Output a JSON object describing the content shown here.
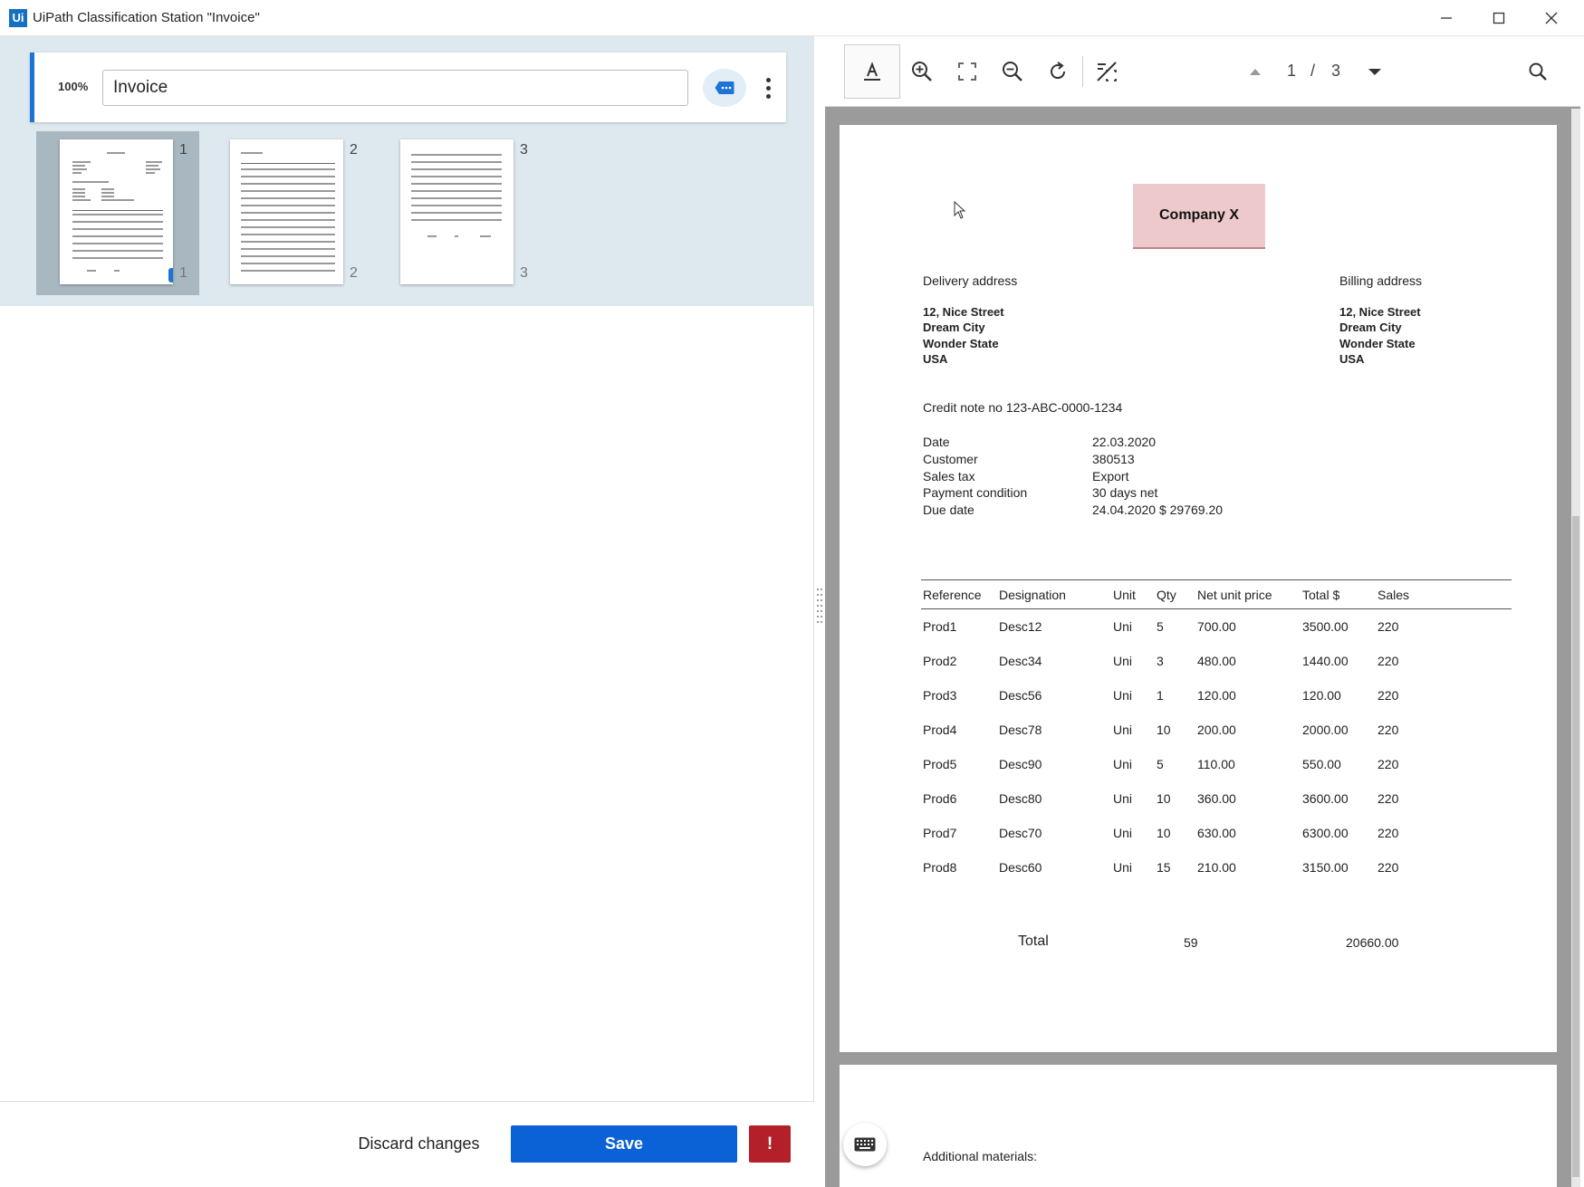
{
  "window": {
    "logo": "Ui",
    "title": "UiPath Classification Station \"Invoice\"",
    "controls": {
      "minimize": "—",
      "maximize": "☐",
      "close": "✕"
    }
  },
  "classification": {
    "confidence": "100%",
    "doc_type_value": "Invoice",
    "tag_icon": "tag-icon",
    "more_icon": "more-vertical-icon",
    "accent_color": "#1e73d6"
  },
  "thumbnails": [
    {
      "page": "1",
      "selected": true
    },
    {
      "page": "2",
      "selected": false
    },
    {
      "page": "3",
      "selected": false
    }
  ],
  "actions": {
    "discard": "Discard changes",
    "save": "Save",
    "warning": "!"
  },
  "viewer": {
    "page_current": "1",
    "page_separator": "/",
    "page_total": "3",
    "tools": [
      "text-select-icon",
      "zoom-in-icon",
      "fit-page-icon",
      "zoom-out-icon",
      "rotate-icon",
      "toggle-ocr-icon"
    ]
  },
  "document": {
    "company": "Company X",
    "delivery_label": "Delivery address",
    "billing_label": "Billing address",
    "delivery_address": [
      "12, Nice Street",
      "Dream City",
      "Wonder State",
      "USA"
    ],
    "billing_address": [
      "12, Nice Street",
      "Dream City",
      "Wonder State",
      "USA"
    ],
    "credit_note": "Credit note no 123-ABC-0000-1234",
    "details": [
      {
        "label": "Date",
        "value": "22.03.2020"
      },
      {
        "label": "Customer",
        "value": "380513"
      },
      {
        "label": "Sales tax",
        "value": "Export"
      },
      {
        "label": "Payment condition",
        "value": "30 days net"
      },
      {
        "label": "Due date",
        "value": "24.04.2020 $ 29769.20"
      }
    ],
    "table_headers": [
      "Reference",
      "Designation",
      "Unit",
      "Qty",
      "Net unit price",
      "Total $",
      "Sales"
    ],
    "rows": [
      [
        "Prod1",
        "Desc12",
        "Uni",
        "5",
        "700.00",
        "3500.00",
        "220"
      ],
      [
        "Prod2",
        "Desc34",
        "Uni",
        "3",
        "480.00",
        "1440.00",
        "220"
      ],
      [
        "Prod3",
        "Desc56",
        "Uni",
        "1",
        "120.00",
        "120.00",
        "220"
      ],
      [
        "Prod4",
        "Desc78",
        "Uni",
        "10",
        "200.00",
        "2000.00",
        "220"
      ],
      [
        "Prod5",
        "Desc90",
        "Uni",
        "5",
        "110.00",
        "550.00",
        "220"
      ],
      [
        "Prod6",
        "Desc80",
        "Uni",
        "10",
        "360.00",
        "3600.00",
        "220"
      ],
      [
        "Prod7",
        "Desc70",
        "Uni",
        "10",
        "630.00",
        "6300.00",
        "220"
      ],
      [
        "Prod8",
        "Desc60",
        "Uni",
        "15",
        "210.00",
        "3150.00",
        "220"
      ]
    ],
    "total_label": "Total",
    "total_qty": "59",
    "total_amount": "20660.00",
    "page2_text": "Additional materials:"
  }
}
